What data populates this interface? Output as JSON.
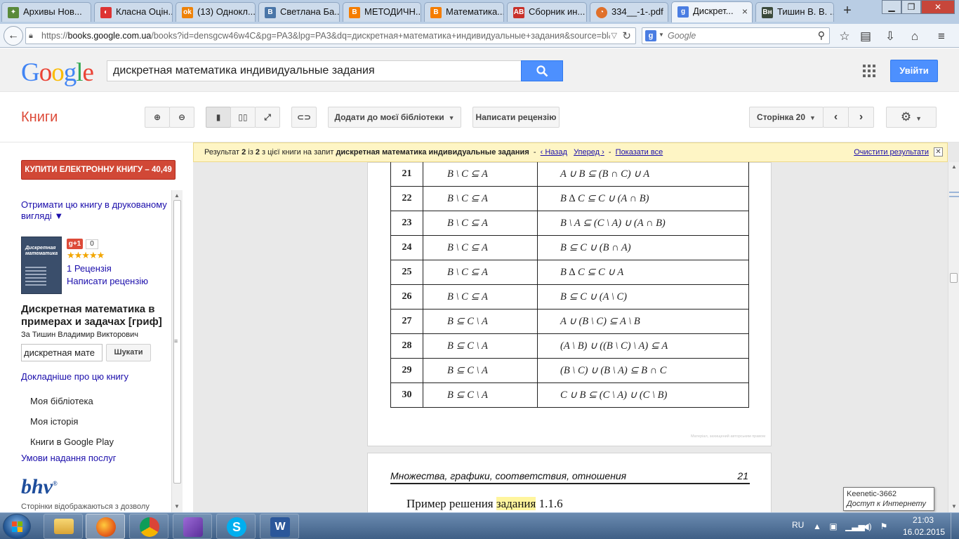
{
  "browser": {
    "tabs": [
      {
        "label": "Архивы Нов...",
        "icon": "favicon-news-icon",
        "color": "#5a8a3a"
      },
      {
        "label": "Класна Оцін...",
        "icon": "favicon-klasna-icon",
        "color": "#d33"
      },
      {
        "label": "(13) Однокл...",
        "icon": "favicon-odnoklassniki-icon",
        "color": "#ee8208"
      },
      {
        "label": "Светлана Ба...",
        "icon": "favicon-vk-icon",
        "color": "#4a76a8"
      },
      {
        "label": "МЕТОДИЧН...",
        "icon": "favicon-blogger-icon",
        "color": "#f57d00"
      },
      {
        "label": "Математика...",
        "icon": "favicon-blogger-icon",
        "color": "#f57d00"
      },
      {
        "label": "Сборник ин...",
        "icon": "favicon-ab-icon",
        "color": "#c8302a"
      },
      {
        "label": "334__-1-.pdf",
        "icon": "favicon-pdf-icon",
        "color": "#e0702a"
      },
      {
        "label": "Дискрет...",
        "icon": "favicon-google-icon",
        "color": "#4a7de2"
      },
      {
        "label": "Тишин В. В. ...",
        "icon": "favicon-bn-icon",
        "color": "#3b4a3b"
      }
    ],
    "new_tab": "+",
    "url_domain": "books.google.com.ua",
    "url_prefix": "https://",
    "url_rest": "/books?id=densgcw46w4C&pg=PA3&lpg=PA3&dq=дискретная+математика+индивидуальные+задания&source=bl&ot",
    "search_placeholder": "Google"
  },
  "google": {
    "logo": [
      "G",
      "o",
      "o",
      "g",
      "l",
      "e"
    ],
    "logo_colors": [
      "#4285f4",
      "#ea4335",
      "#fbbc05",
      "#4285f4",
      "#34a853",
      "#ea4335"
    ],
    "query": "дискретная математика индивидуальные задания",
    "signin_label": "Увійти"
  },
  "toolbar": {
    "books_label": "Книги",
    "add_library_label": "Додати до моєї бібліотеки",
    "write_review_label": "Написати рецензію",
    "page_label": "Сторінка 20"
  },
  "sidebar": {
    "buy_label": "КУПИТИ ЕЛЕКТРОННУ КНИГУ – 40,49 ₴",
    "print_link": "Отримати цю книгу в друкованому вигляді ▼",
    "gplus": "g+1",
    "gplus_count": "0",
    "stars": "★★★★★",
    "reviews_link": "1 Рецензія",
    "write_review_link": "Написати рецензію",
    "book_title": "Дискретная математика в примерах и задачах [гриф]",
    "author": "За Тишин Владимир Викторович",
    "inbook_query": "дискретная мате",
    "inbook_button": "Шукати",
    "more_about_link": "Докладніше про цю книгу",
    "my_library": "Моя бібліотека",
    "my_history": "Моя історія",
    "google_play": "Книги в Google Play",
    "terms_link": "Умови надання послуг",
    "publisher_logo": "bhv",
    "footer": "Сторінки відображаються з дозволу"
  },
  "results": {
    "prefix": "Результат ",
    "n1": "2",
    "mid1": " із ",
    "n2": "2",
    "mid2": " з цієї книги на запит ",
    "query": "дискретная математика индивидуальные задания",
    "back": "‹ Назад",
    "forward": "Уперед ›",
    "show_all": "Показати все",
    "clear": "Очистити результати"
  },
  "table": [
    {
      "n": "21",
      "a": "B \\ C ⊆ A",
      "b": "A ∪ B ⊆ (B ∩ C) ∪ A"
    },
    {
      "n": "22",
      "a": "B \\ C ⊆ A",
      "b": "B ∆ C ⊆ C ∪ (A ∩ B)"
    },
    {
      "n": "23",
      "a": "B \\ C ⊆ A",
      "b": "B \\ A ⊆ (C \\ A) ∪ (A ∩ B)"
    },
    {
      "n": "24",
      "a": "B \\ C ⊆ A",
      "b": "B ⊆ C ∪ (B ∩ A)"
    },
    {
      "n": "25",
      "a": "B \\ C ⊆ A",
      "b": "B ∆ C ⊆ C ∪ A"
    },
    {
      "n": "26",
      "a": "B \\ C ⊆ A",
      "b": "B ⊆ C ∪ (A \\ C)"
    },
    {
      "n": "27",
      "a": "B ⊆ C \\ A",
      "b": "A ∪ (B \\ C) ⊆ A \\ B"
    },
    {
      "n": "28",
      "a": "B ⊆ C \\ A",
      "b": "(A \\ B) ∪ ((B \\ C) \\ A) ⊆ A"
    },
    {
      "n": "29",
      "a": "B ⊆ C \\ A",
      "b": "(B \\ C) ∪ (B \\ A) ⊆ B ∩ C"
    },
    {
      "n": "30",
      "a": "B ⊆ C \\ A",
      "b": "C ∪ B ⊆ (C \\ A) ∪ (C \\ B)"
    }
  ],
  "page1_copyright": "Матеріал, захищений авторським правом",
  "page2": {
    "header": "Множества, графики, соответствия, отношения",
    "page_number": "21",
    "text_before": "Пример решения ",
    "highlight": "задания",
    "text_after": " 1.1.6"
  },
  "tooltip": {
    "line1": "Keenetic-3662",
    "line2": "Доступ к Интернету"
  },
  "taskbar": {
    "lang": "RU",
    "time": "21:03",
    "date": "16.02.2015"
  }
}
